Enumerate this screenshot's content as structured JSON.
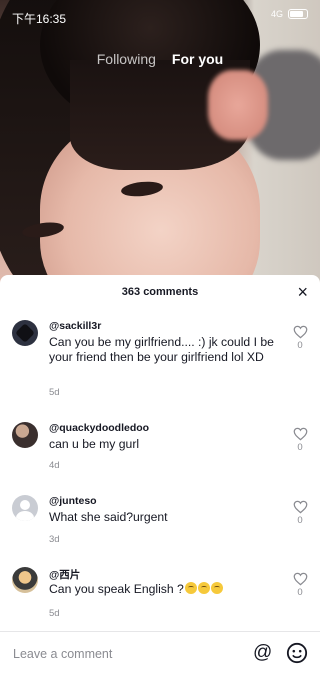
{
  "status": {
    "time": "下午16:35",
    "network": "4G"
  },
  "feed": {
    "tabs": [
      "Following",
      "For you"
    ]
  },
  "comments_sheet": {
    "title": "363 comments",
    "close": "×",
    "comments": [
      {
        "user": "@sackill3r",
        "text": "Can you be my girlfriend.... :) jk could I be your friend then be your girlfriend lol XD",
        "date": "5d",
        "likes": "0"
      },
      {
        "user": "@quackydoodledoo",
        "text": "can u be my gurl",
        "date": "4d",
        "likes": "0"
      },
      {
        "user": "@junteso",
        "text": "What she said?urgent",
        "date": "3d",
        "likes": "0"
      },
      {
        "user": "@西片",
        "text": "Can you speak English ?",
        "date": "5d",
        "likes": "0",
        "emoji_count": 3
      }
    ],
    "input": {
      "placeholder": "Leave a comment",
      "at_symbol": "@"
    }
  },
  "colors": {
    "text": "#161823",
    "muted": "#8a8b91",
    "sheet": "#ffffff"
  },
  "icons": [
    "heart-outline-icon",
    "close-icon",
    "at-icon",
    "emoji-icon",
    "battery-icon"
  ]
}
